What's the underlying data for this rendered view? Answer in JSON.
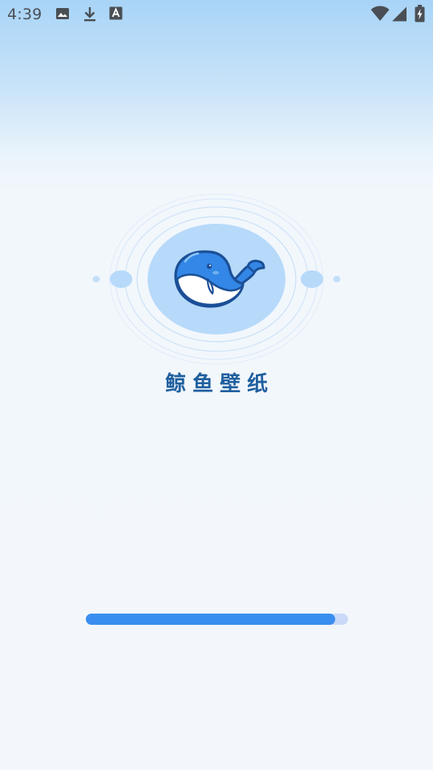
{
  "status_bar": {
    "time": "4:39",
    "left_icons": [
      "image-icon",
      "download-icon",
      "font-icon"
    ],
    "right_icons": [
      "wifi-icon",
      "cellular-signal-icon",
      "battery-charging-icon"
    ]
  },
  "splash": {
    "app_name": "鲸鱼壁纸",
    "logo_icon": "whale-icon",
    "progress": 0.95
  },
  "colors": {
    "accent": "#3a8ef0",
    "track": "#c9d9f7",
    "title": "#1f5f9e",
    "logo_disc": "#b7dafa",
    "whale_body": "#3387e6",
    "whale_outline": "#1b4f97"
  }
}
